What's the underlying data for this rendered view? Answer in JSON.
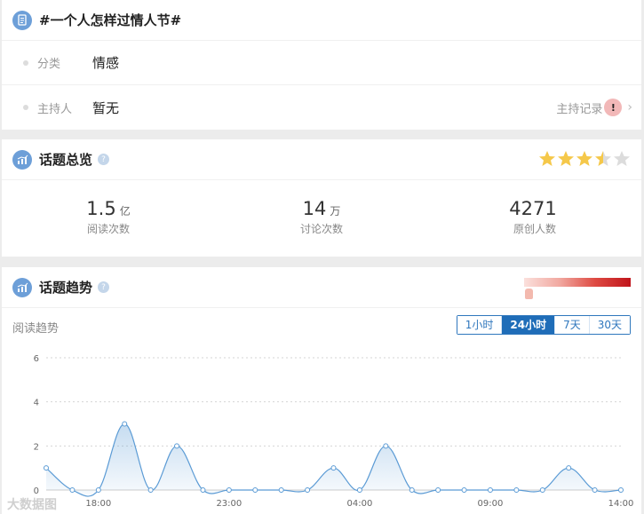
{
  "header": {
    "title": "#一个人怎样过情人节#",
    "icon": "document-icon"
  },
  "info": {
    "category_label": "分类",
    "category_value": "情感",
    "host_label": "主持人",
    "host_value": "暂无",
    "host_record": "主持记录",
    "host_avatar_glyph": "!"
  },
  "overview": {
    "title": "话题总览",
    "icon": "chart-icon",
    "help_glyph": "?",
    "rating": 3.5,
    "rating_max": 5,
    "star_color": "#f5c84a",
    "stats": [
      {
        "value": "1.5",
        "unit": "亿",
        "label": "阅读次数"
      },
      {
        "value": "14",
        "unit": "万",
        "label": "讨论次数"
      },
      {
        "value": "4271",
        "unit": "",
        "label": "原创人数"
      }
    ]
  },
  "trend": {
    "title": "话题趋势",
    "icon": "chart-icon",
    "help_glyph": "?",
    "subtitle": "阅读趋势",
    "tabs": [
      "1小时",
      "24小时",
      "7天",
      "30天"
    ],
    "active_tab": "24小时",
    "watermark": "大数据图"
  },
  "chart_data": {
    "type": "line",
    "x": [
      "16:00",
      "17:00",
      "18:00",
      "19:00",
      "20:00",
      "21:00",
      "22:00",
      "23:00",
      "00:00",
      "01:00",
      "02:00",
      "03:00",
      "04:00",
      "05:00",
      "06:00",
      "07:00",
      "08:00",
      "09:00",
      "10:00",
      "11:00",
      "12:00",
      "13:00",
      "14:00"
    ],
    "x_tick_labels": [
      "18:00",
      "23:00",
      "04:00",
      "09:00",
      "14:00"
    ],
    "series": [
      {
        "values": [
          1,
          0,
          0,
          3,
          0,
          2,
          0,
          0,
          0,
          0,
          0,
          1,
          0,
          2,
          0,
          0,
          0,
          0,
          0,
          0,
          1,
          0,
          0
        ],
        "color": "#5b9bd5"
      }
    ],
    "ylim": [
      0,
      6
    ],
    "yticks": [
      0,
      2,
      4,
      6
    ],
    "grid": true
  }
}
